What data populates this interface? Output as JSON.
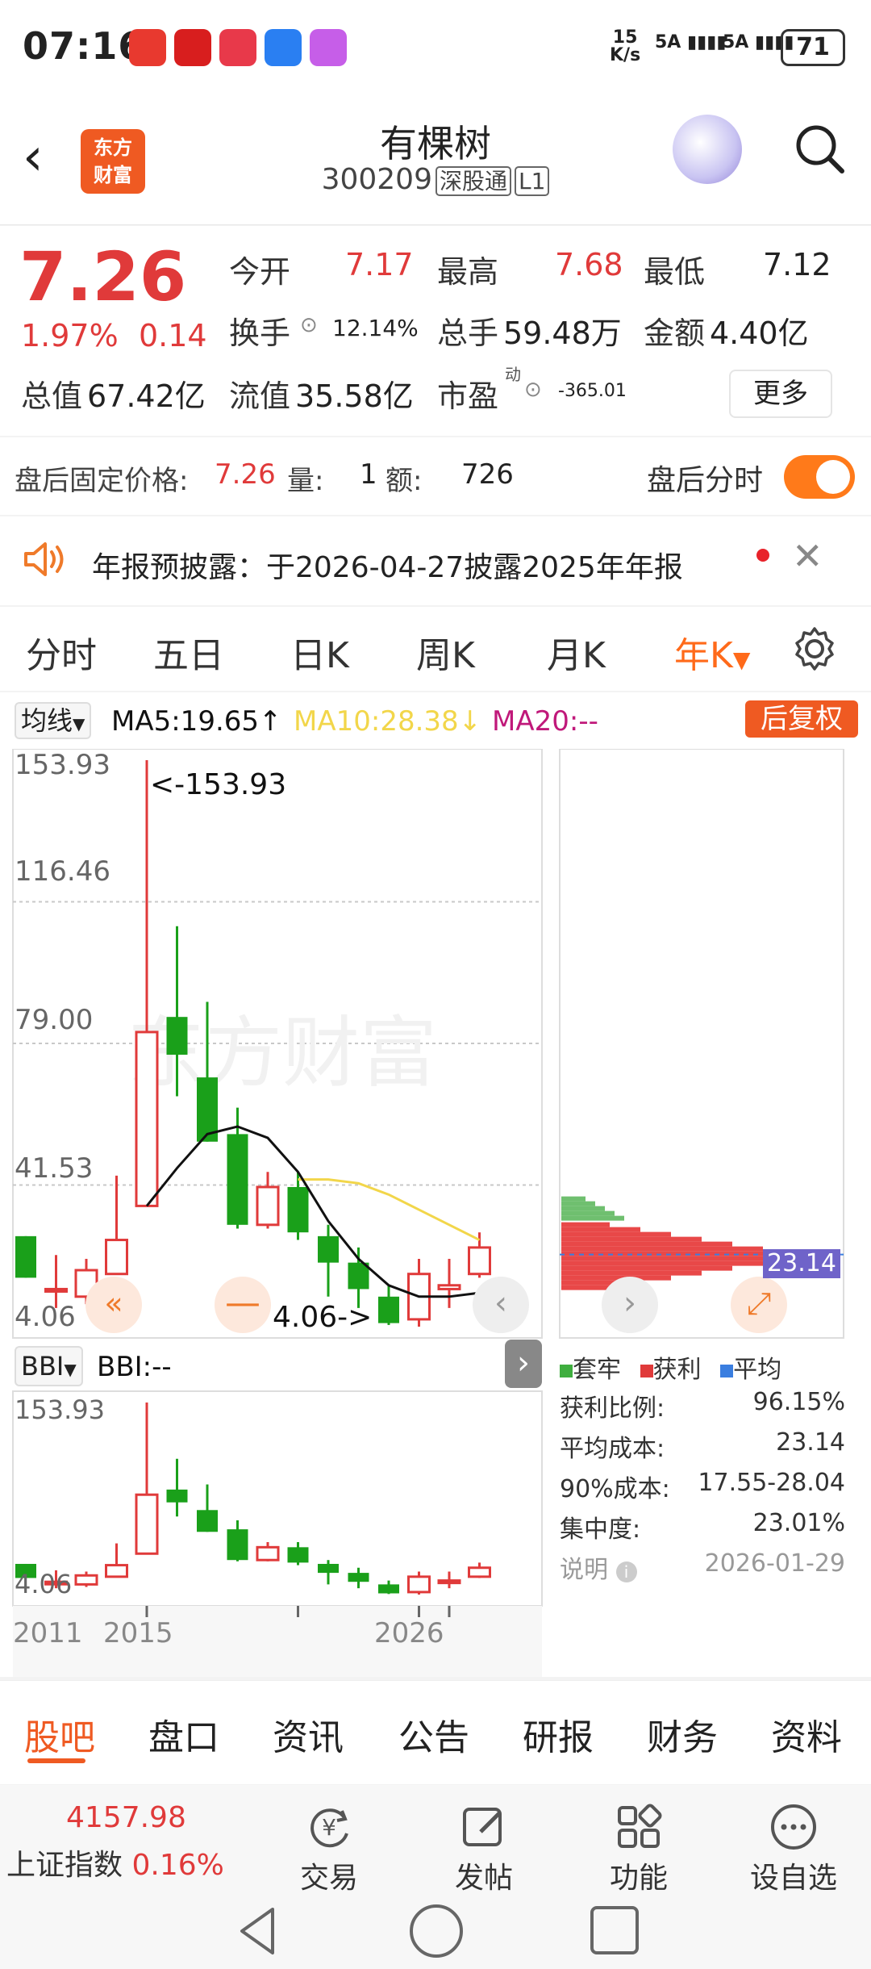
{
  "status_bar": {
    "time": "07:16",
    "net_speed_top": "15",
    "net_speed_bottom": "K/s",
    "signal1": "5A",
    "signal2": "5A",
    "battery": "71"
  },
  "header": {
    "logo_line1": "东方",
    "logo_line2": "财富",
    "name": "有棵树",
    "code": "300209",
    "tag1": "深股通",
    "tag2": "L1"
  },
  "quote": {
    "price": "7.26",
    "change_pct": "1.97%",
    "change": "0.14",
    "open_label": "今开",
    "open": "7.17",
    "high_label": "最高",
    "high": "7.68",
    "low_label": "最低",
    "low": "7.12",
    "turnover_label": "换手",
    "turnover": "12.14%",
    "volume_label": "总手",
    "volume": "59.48万",
    "amount_label": "金额",
    "amount": "4.40亿",
    "mktcap_label": "总值",
    "mktcap": "67.42亿",
    "float_label": "流值",
    "float": "35.58亿",
    "pe_label": "市盈",
    "pe_sup": "动",
    "pe": "-365.01",
    "more_button": "更多"
  },
  "after_hours": {
    "label": "盘后固定价格:",
    "price": "7.26",
    "vol_label": "量:",
    "vol": "1",
    "amt_label": "额:",
    "amt": "726",
    "toggle_label": "盘后分时",
    "toggle_on": true
  },
  "announcement": {
    "text": "年报预披露：于2026-04-27披露2025年年报"
  },
  "period_tabs": [
    "分时",
    "五日",
    "日K",
    "周K",
    "月K",
    "年K"
  ],
  "active_period": "年K",
  "ma_row": {
    "selector": "均线",
    "ma5": "MA5:19.65",
    "ma5_arrow": "↑",
    "ma10": "MA10:28.38",
    "ma10_arrow": "↓",
    "ma20": "MA20:--",
    "adjust": "后复权"
  },
  "colors": {
    "up": "#e03a3a",
    "down": "#1aa01a",
    "ma5": "#111111",
    "ma10": "#f2d64a",
    "ma20": "#c0187a",
    "accent": "#ff7a1a"
  },
  "indicator": {
    "selector": "BBI",
    "value": "BBI:--"
  },
  "chart_data": {
    "type": "candlestick",
    "title": "",
    "y_labels": [
      "153.93",
      "116.46",
      "79.00",
      "41.53",
      "4.06"
    ],
    "ylim": [
      4.06,
      153.93
    ],
    "max_marker": "<-153.93",
    "min_marker": "4.06->",
    "x_labels": [
      "2011",
      "2015",
      "2026"
    ],
    "candles": [
      {
        "o": 28,
        "c": 17,
        "h": 28,
        "l": 17
      },
      {
        "o": 14,
        "c": 14,
        "h": 23,
        "l": 9
      },
      {
        "o": 12,
        "c": 19,
        "h": 22,
        "l": 10
      },
      {
        "o": 18,
        "c": 27,
        "h": 44,
        "l": 18
      },
      {
        "o": 36,
        "c": 82,
        "h": 153.93,
        "l": 36
      },
      {
        "o": 86,
        "c": 76,
        "h": 110,
        "l": 65
      },
      {
        "o": 70,
        "c": 53,
        "h": 90,
        "l": 53
      },
      {
        "o": 55,
        "c": 31,
        "h": 62,
        "l": 30
      },
      {
        "o": 31,
        "c": 41,
        "h": 45,
        "l": 30
      },
      {
        "o": 41,
        "c": 29,
        "h": 45,
        "l": 27
      },
      {
        "o": 28,
        "c": 21,
        "h": 31,
        "l": 12
      },
      {
        "o": 21,
        "c": 14,
        "h": 25,
        "l": 9
      },
      {
        "o": 12,
        "c": 5,
        "h": 15,
        "l": 4.5
      },
      {
        "o": 6,
        "c": 18,
        "h": 22,
        "l": 4.06
      },
      {
        "o": 14,
        "c": 15,
        "h": 22,
        "l": 9
      },
      {
        "o": 18,
        "c": 25,
        "h": 29,
        "l": 17
      }
    ],
    "ma5": [
      null,
      null,
      null,
      null,
      36,
      46,
      55,
      57,
      54,
      45,
      32,
      22,
      15,
      12,
      12,
      13
    ],
    "ma10": [
      null,
      null,
      null,
      null,
      null,
      null,
      null,
      null,
      null,
      43,
      43,
      42,
      39,
      35,
      31,
      27
    ]
  },
  "chip_panel": {
    "avg_line_label": "23.14",
    "legend": [
      "套牢",
      "获利",
      "平均"
    ],
    "rows": [
      {
        "label": "获利比例:",
        "value": "96.15%"
      },
      {
        "label": "平均成本:",
        "value": "23.14"
      },
      {
        "label": "90%成本:",
        "value": "17.55-28.04"
      },
      {
        "label": "集中度:",
        "value": "23.01%"
      },
      {
        "label": "说明",
        "value": "2026-01-29"
      }
    ]
  },
  "f10_tabs": [
    "股吧",
    "盘口",
    "资讯",
    "公告",
    "研报",
    "财务",
    "资料"
  ],
  "active_f10": "股吧",
  "bottom_bar": {
    "index_value": "4157.98",
    "index_name": "上证指数",
    "index_change": "0.16%",
    "items": [
      "交易",
      "发帖",
      "功能",
      "设自选"
    ]
  }
}
